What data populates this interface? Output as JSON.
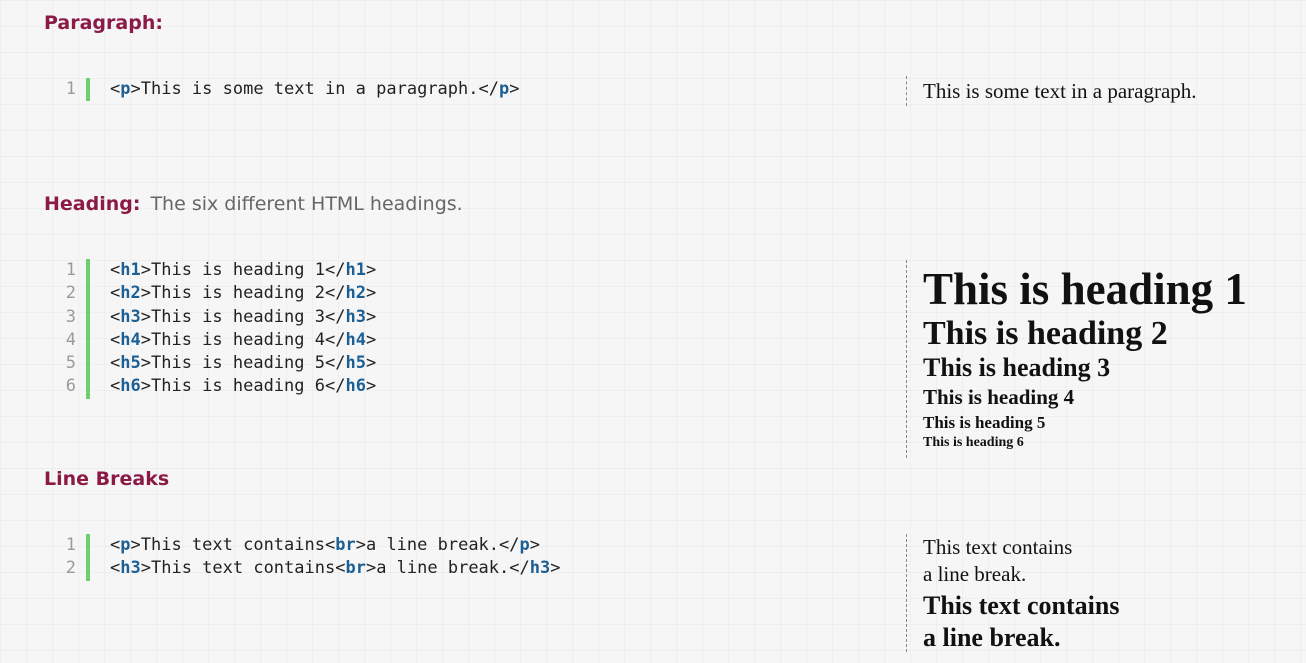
{
  "sections": [
    {
      "title": "Paragraph:",
      "description": "",
      "code_lines": [
        {
          "number": "1",
          "open_tag": "p",
          "text": "This is some text in a paragraph."
        }
      ],
      "output": {
        "paragraph": "This is some text in a paragraph."
      }
    },
    {
      "title": "Heading:",
      "description": "The six different HTML headings.",
      "code_lines": [
        {
          "number": "1",
          "open_tag": "h1",
          "text": "This is heading 1"
        },
        {
          "number": "2",
          "open_tag": "h2",
          "text": "This is heading 2"
        },
        {
          "number": "3",
          "open_tag": "h3",
          "text": "This is heading 3"
        },
        {
          "number": "4",
          "open_tag": "h4",
          "text": "This is heading 4"
        },
        {
          "number": "5",
          "open_tag": "h5",
          "text": "This is heading 5"
        },
        {
          "number": "6",
          "open_tag": "h6",
          "text": "This is heading 6"
        }
      ],
      "output": {
        "headings": [
          "This is heading 1",
          "This is heading 2",
          "This is heading 3",
          "This is heading 4",
          "This is heading 5",
          "This is heading 6"
        ]
      }
    },
    {
      "title": "Line Breaks",
      "description": "",
      "code_lines": [
        {
          "number": "1",
          "open_tag": "p",
          "text_before": "This text contains",
          "br_tag": "br",
          "text_after": "a line break."
        },
        {
          "number": "2",
          "open_tag": "h3",
          "text_before": "This text contains",
          "br_tag": "br",
          "text_after": "a line break."
        }
      ],
      "output": {
        "paragraph_line1": "This text contains",
        "paragraph_line2": "a line break.",
        "heading_line1": "This text contains",
        "heading_line2": "a line break."
      }
    }
  ]
}
